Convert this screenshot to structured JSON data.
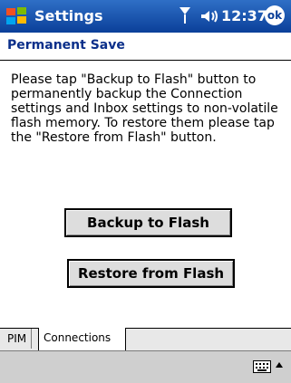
{
  "titlebar": {
    "title": "Settings",
    "time": "12:37",
    "ok_label": "ok",
    "icons": [
      "windows-start-icon",
      "antenna-signal-icon",
      "speaker-volume-icon"
    ]
  },
  "section": {
    "title": "Permanent Save"
  },
  "main": {
    "instructions": "Please tap \"Backup to Flash\" button to permanently backup the Connection settings and Inbox settings to non-volatile flash memory. To restore them please tap the \"Restore from Flash\" button.",
    "backup_label": "Backup to Flash",
    "restore_label": "Restore from Flash"
  },
  "tabs": [
    {
      "label": "PIM"
    },
    {
      "label": "Connections"
    }
  ],
  "bottombar": {
    "icons": [
      "keyboard-icon",
      "sip-arrow-up-icon"
    ]
  },
  "colors": {
    "title_bar": "#0b3f99",
    "section_title": "#0b2f8a",
    "button_bg": "#dddddd",
    "bottom_bar": "#cfcfcf"
  }
}
